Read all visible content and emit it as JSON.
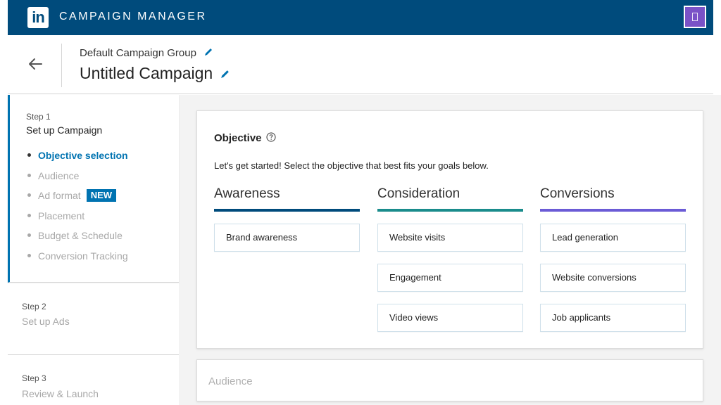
{
  "topbar": {
    "logo_text": "in",
    "app_title": "CAMPAIGN MANAGER",
    "brand_color": "#004b7c",
    "account_color": "#7a52c7"
  },
  "header": {
    "group_name": "Default Campaign Group",
    "campaign_name": "Untitled Campaign"
  },
  "sidebar": {
    "step1": {
      "number": "Step 1",
      "title": "Set up Campaign",
      "items": [
        {
          "label": "Objective selection",
          "active": true
        },
        {
          "label": "Audience"
        },
        {
          "label": "Ad format",
          "badge": "NEW"
        },
        {
          "label": "Placement"
        },
        {
          "label": "Budget & Schedule"
        },
        {
          "label": "Conversion Tracking"
        }
      ]
    },
    "step2": {
      "number": "Step 2",
      "title": "Set up Ads"
    },
    "step3": {
      "number": "Step 3",
      "title": "Review & Launch"
    }
  },
  "objective": {
    "title": "Objective",
    "description": "Let's get started! Select the objective that best fits your goals below.",
    "columns": [
      {
        "heading": "Awareness",
        "color": "#004b7c",
        "options": [
          "Brand awareness"
        ]
      },
      {
        "heading": "Consideration",
        "color": "#1a8c8c",
        "options": [
          "Website visits",
          "Engagement",
          "Video views"
        ]
      },
      {
        "heading": "Conversions",
        "color": "#6b5bd6",
        "options": [
          "Lead generation",
          "Website conversions",
          "Job applicants"
        ]
      }
    ]
  },
  "audience": {
    "title": "Audience"
  }
}
